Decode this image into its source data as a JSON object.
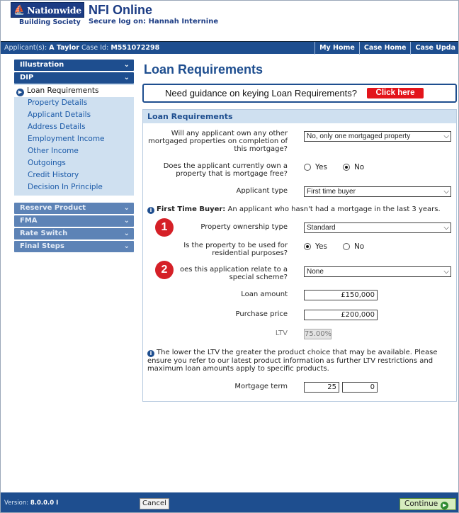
{
  "header": {
    "logo_text": "Nationwide",
    "logo_sub": "Building Society",
    "app_title": "NFI Online",
    "logon": "Secure log on: Hannah Internine",
    "applicant_label": "Applicant(s):",
    "applicant_name": "A Taylor",
    "case_label": "Case Id:",
    "case_id": "M551072298",
    "nav": [
      "My Home",
      "Case Home",
      "Case Upda"
    ]
  },
  "sidebar": {
    "sections": [
      {
        "label": "Illustration"
      },
      {
        "label": "DIP"
      }
    ],
    "dip_items": [
      "Loan Requirements",
      "Property Details",
      "Applicant Details",
      "Address Details",
      "Employment Income",
      "Other Income",
      "Outgoings",
      "Credit History",
      "Decision In Principle"
    ],
    "lower_sections": [
      "Reserve Product",
      "FMA",
      "Rate Switch",
      "Final Steps"
    ]
  },
  "main": {
    "title": "Loan Requirements",
    "guidance_text": "Need guidance on keying Loan Requirements?",
    "guidance_button": "Click here",
    "panel_title": "Loan Requirements",
    "q_other_mortgaged": "Will any applicant own any other mortgaged properties on completion of this mortgage?",
    "other_mortgaged_value": "No, only one mortgaged property",
    "q_mortgage_free": "Does the applicant currently own a property that is mortgage free?",
    "yes": "Yes",
    "no": "No",
    "mortgage_free_selected": "No",
    "q_applicant_type": "Applicant type",
    "applicant_type_value": "First time buyer",
    "ftb_info_bold": "First Time Buyer:",
    "ftb_info": "An applicant who hasn't had a mortgage in the last 3 years.",
    "q_ownership": "Property ownership type",
    "ownership_value": "Standard",
    "q_residential": "Is the property to be used for residential purposes?",
    "residential_selected": "Yes",
    "q_scheme": "oes this application relate to a special scheme?",
    "scheme_value": "None",
    "q_loan": "Loan amount",
    "loan_value": "£150,000",
    "q_price": "Purchase price",
    "price_value": "£200,000",
    "q_ltv": "LTV",
    "ltv_value": "75.00%",
    "ltv_info": "The lower the LTV the greater the product choice that may be available. Please ensure you refer to our latest product information as further LTV restrictions and maximum loan amounts apply to specific products.",
    "q_term": "Mortgage term",
    "term_years": "25",
    "term_months": "0",
    "badge1": "1",
    "badge2": "2"
  },
  "footer": {
    "version_label": "Version:",
    "version": "8.0.0.0 I",
    "cancel": "Cancel",
    "continue": "Continue"
  }
}
